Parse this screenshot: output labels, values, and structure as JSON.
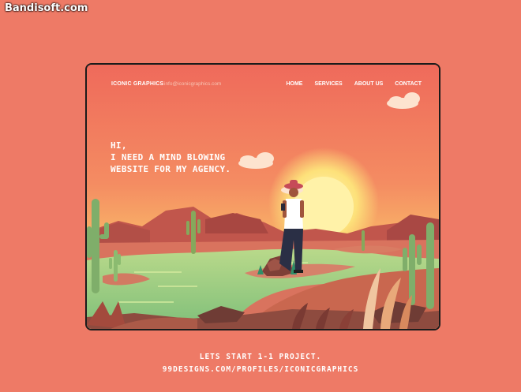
{
  "watermark": "Bandisoft.com",
  "nav": {
    "brand": "ICONIC GRAPHICS",
    "email": "info@iconicgraphics.com",
    "menu": [
      "HOME",
      "SERVICES",
      "ABOUT US",
      "CONTACT"
    ]
  },
  "hero": {
    "lines": [
      "HI,",
      "I NEED A MIND BLOWING",
      "WEBSITE FOR MY AGENCY."
    ]
  },
  "footer": {
    "line1": "LETS START 1-1 PROJECT.",
    "line2": "99DESIGNS.COM/PROFILES/ICONICGRAPHICS"
  },
  "colors": {
    "background": "#ee7a66",
    "sky_top": "#f06b5c",
    "sun": "#fff0a0",
    "water": "#9ccf8a",
    "ground": "#c86a55"
  }
}
